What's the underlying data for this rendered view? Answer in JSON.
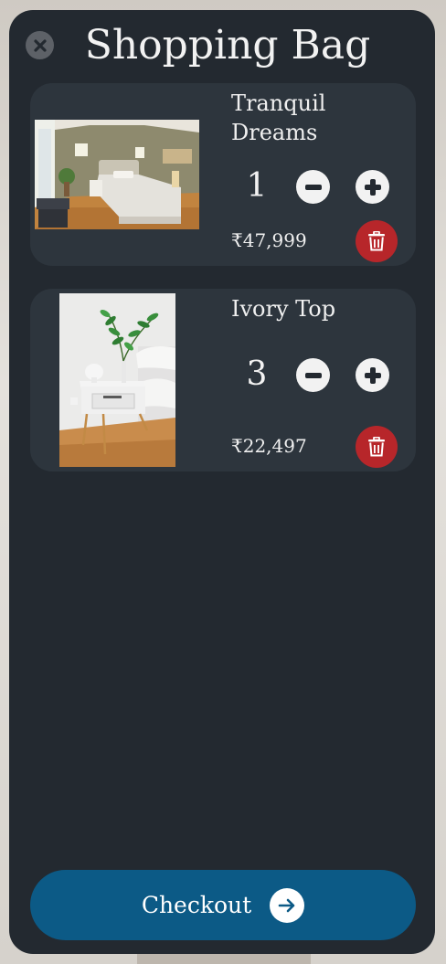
{
  "header": {
    "title": "Shopping Bag",
    "close_icon": "close-icon"
  },
  "cart": {
    "items": [
      {
        "name": "Tranquil Dreams",
        "quantity": "1",
        "price": "₹47,999",
        "image": "bedroom-photo"
      },
      {
        "name": "Ivory Top",
        "quantity": "3",
        "price": "₹22,497",
        "image": "nightstand-photo"
      }
    ]
  },
  "checkout": {
    "label": "Checkout",
    "icon": "arrow-right-icon"
  },
  "colors": {
    "panel": "#232930",
    "card": "#2d353d",
    "accent": "#0c5a86",
    "danger": "#b7262a"
  }
}
